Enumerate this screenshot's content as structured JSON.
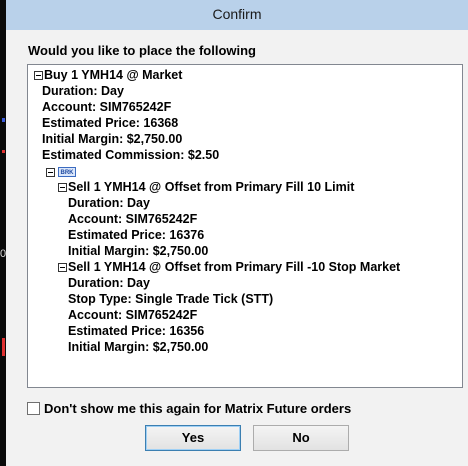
{
  "window": {
    "title": "Confirm"
  },
  "prompt": "Would you like to place the following",
  "order": {
    "main": "Buy 1 YMH14 @ Market",
    "details": [
      "Duration: Day",
      "Account: SIM765242F",
      "Estimated Price: 16368",
      "Initial Margin: $2,750.00",
      "Estimated Commission: $2.50"
    ],
    "bracket_badge": "BRK",
    "legs": [
      {
        "title": "Sell 1 YMH14 @ Offset from Primary Fill 10 Limit",
        "details": [
          "Duration: Day",
          "Account: SIM765242F",
          "Estimated Price: 16376",
          "Initial Margin: $2,750.00"
        ]
      },
      {
        "title": "Sell 1 YMH14 @ Offset from Primary Fill -10 Stop Market",
        "details": [
          "Duration: Day",
          "Stop Type: Single Trade Tick (STT)",
          "Account: SIM765242F",
          "Estimated Price: 16356",
          "Initial Margin: $2,750.00"
        ]
      }
    ]
  },
  "dont_show": {
    "label": "Don't show me this again for Matrix Future orders",
    "checked": false
  },
  "buttons": {
    "yes": "Yes",
    "no": "No"
  },
  "background": {
    "digit": "0"
  }
}
